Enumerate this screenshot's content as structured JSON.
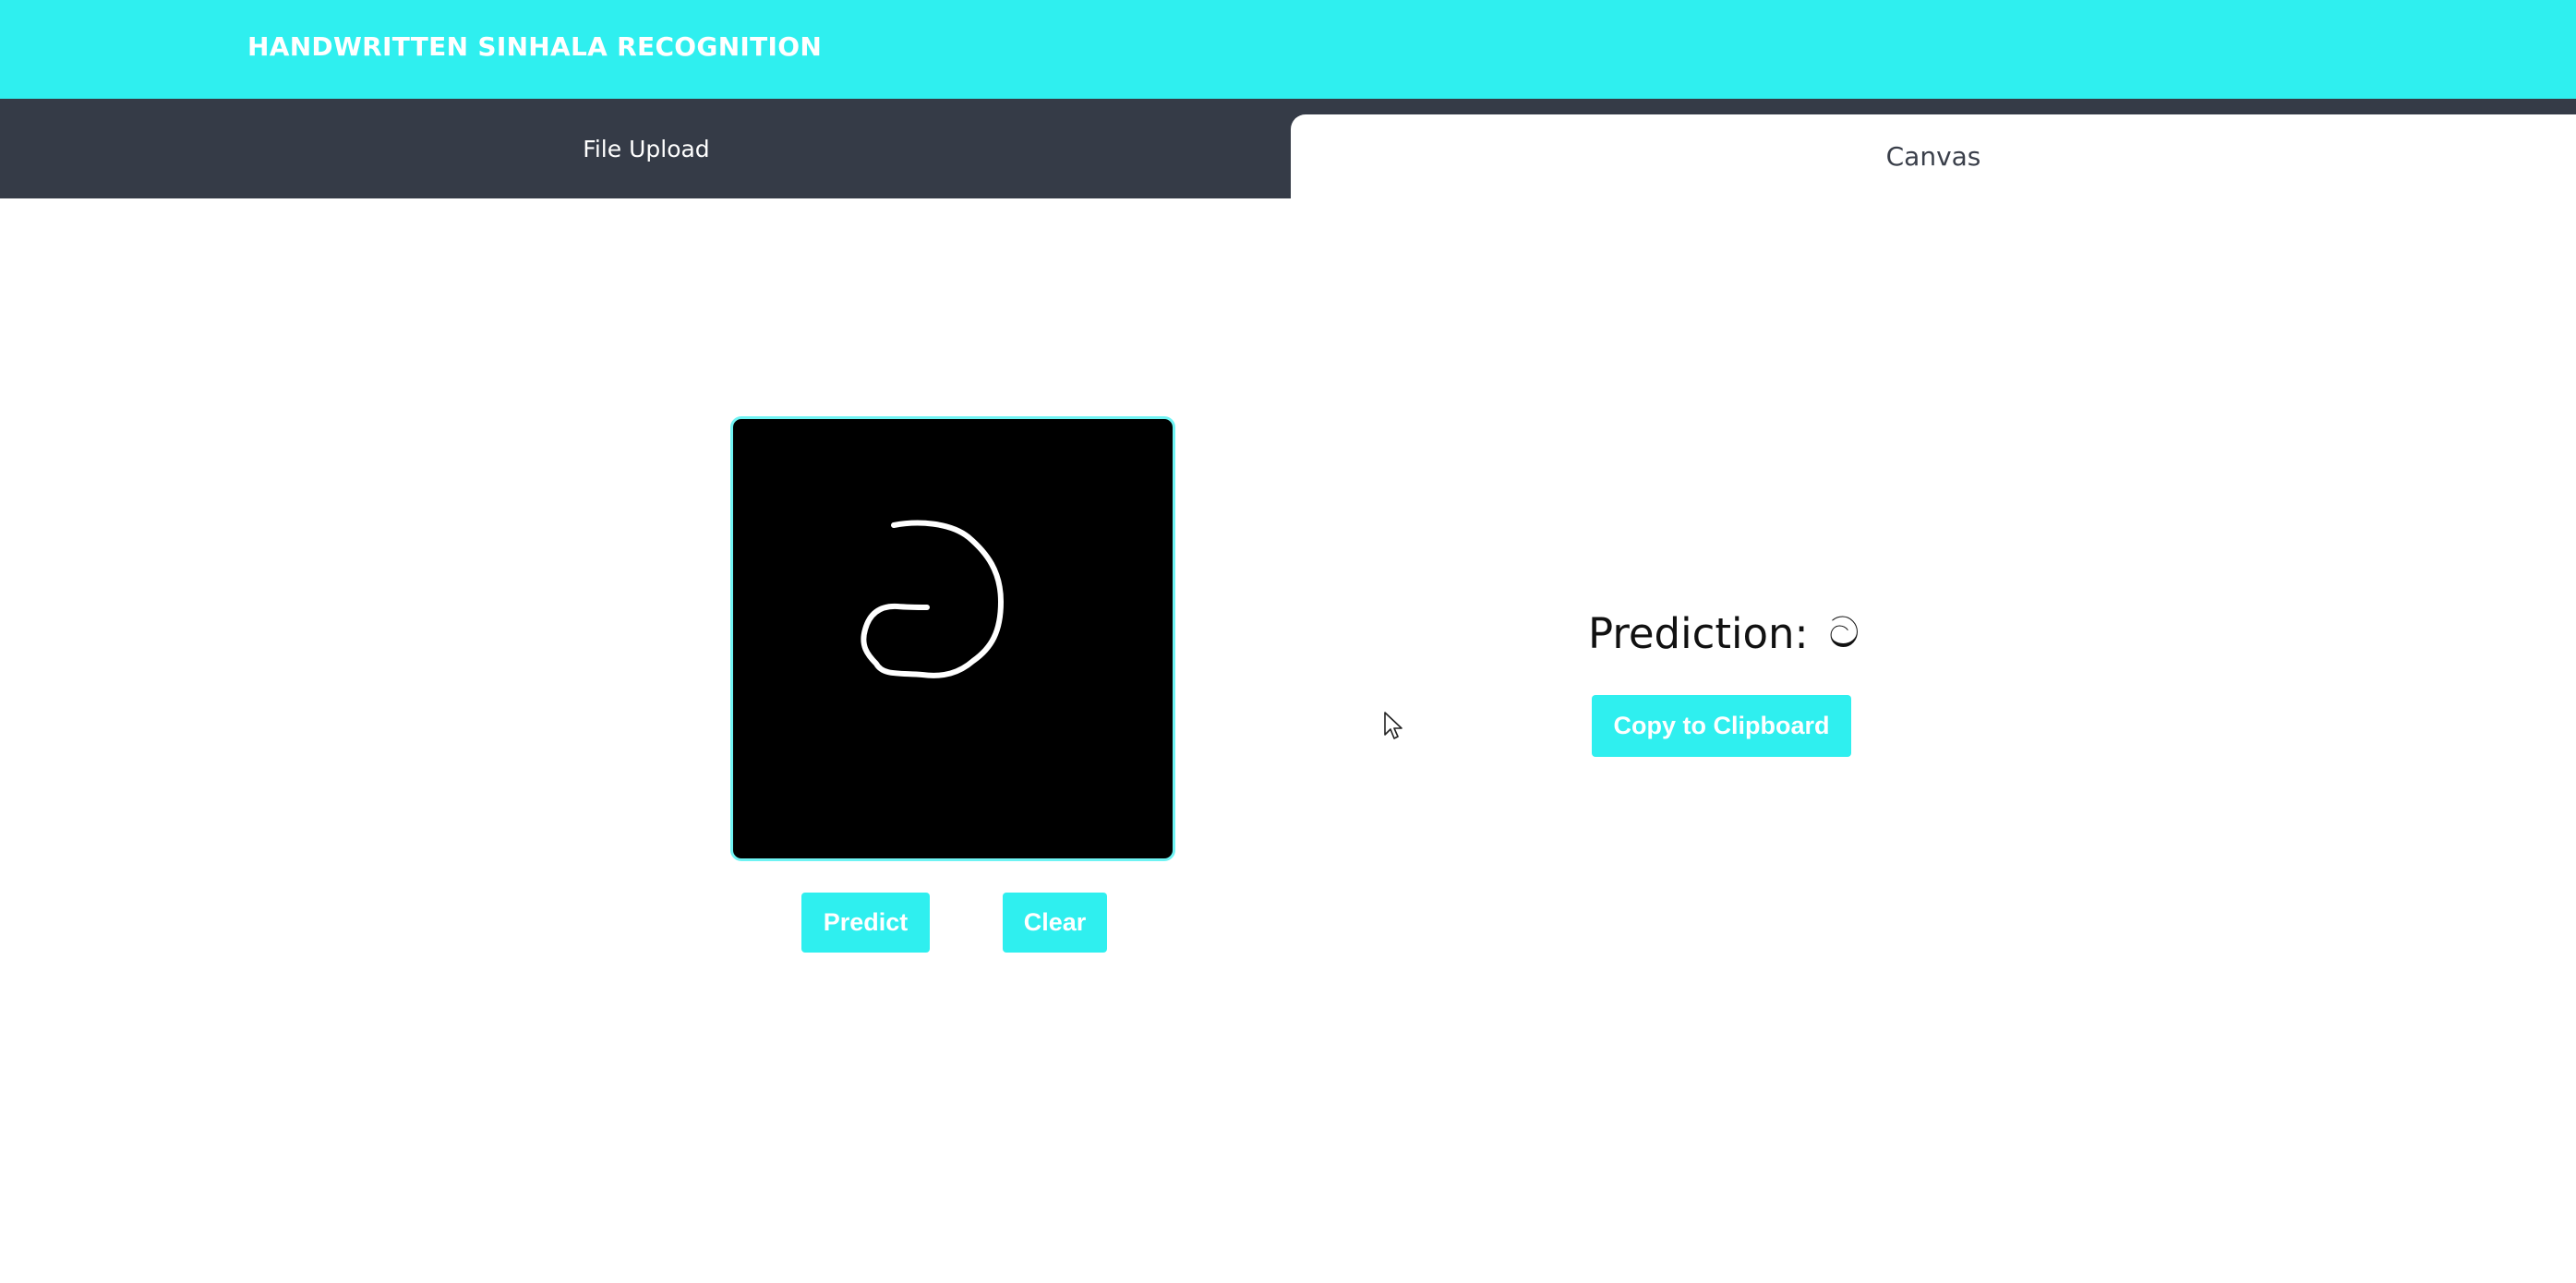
{
  "header": {
    "title": "HANDWRITTEN SINHALA RECOGNITION"
  },
  "tabs": {
    "file_upload": "File Upload",
    "canvas": "Canvas",
    "active": "Canvas"
  },
  "canvas": {
    "predict_label": "Predict",
    "clear_label": "Clear"
  },
  "result": {
    "prediction_label": "Prediction:",
    "prediction_value": "ට",
    "copy_label": "Copy to Clipboard"
  },
  "colors": {
    "accent": "#2fefef",
    "tab_bar": "#353b47",
    "canvas_bg": "#000000",
    "stroke": "#ffffff"
  }
}
